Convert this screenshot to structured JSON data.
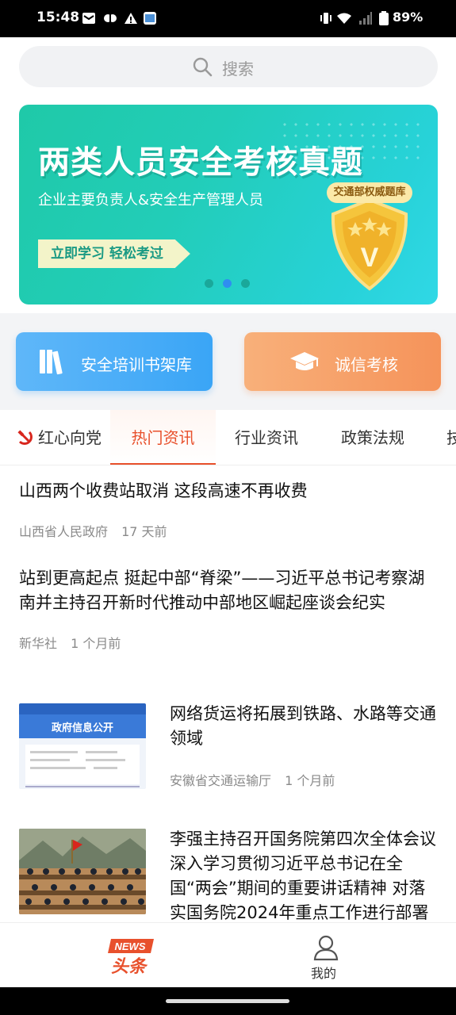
{
  "status_bar": {
    "time": "15:48",
    "battery": "89%"
  },
  "search": {
    "placeholder": "搜索"
  },
  "banner": {
    "title": "两类人员安全考核真题",
    "subtitle": "企业主要负责人&安全生产管理人员",
    "cta": "立即学习 轻松考过",
    "tag": "交通部权威题库",
    "shield_letter": "V",
    "dots": 3,
    "active_dot": 2
  },
  "quick_actions": [
    {
      "label": "安全培训书架库",
      "icon": "books-icon"
    },
    {
      "label": "诚信考核",
      "icon": "graduation-cap-icon"
    }
  ],
  "tabs": [
    {
      "label": "红心向党",
      "icon": "hammer-sickle-icon"
    },
    {
      "label": "热门资讯",
      "active": true
    },
    {
      "label": "行业资讯"
    },
    {
      "label": "政策法规"
    },
    {
      "label": "技"
    }
  ],
  "news": [
    {
      "title": "山西两个收费站取消 这段高速不再收费",
      "source": "山西省人民政府",
      "time": "17 天前"
    },
    {
      "title": "站到更高起点 挺起中部“脊梁”——习近平总书记考察湖南并主持召开新时代推动中部地区崛起座谈会纪实",
      "source": "新华社",
      "time": "1 个月前"
    },
    {
      "title": "网络货运将拓展到铁路、水路等交通领域",
      "source": "安徽省交通运输厅",
      "time": "1 个月前",
      "thumb_caption": "政府信息公开"
    },
    {
      "title": "李强主持召开国务院第四次全体会议 深入学习贯彻习近平总书记在全国“两会”期间的重要讲话精神 对落实国务院2024年重点工作进行部署",
      "source": "",
      "time": ""
    }
  ],
  "bottom_nav": {
    "news_logo_top": "NEWS",
    "news_logo_bottom": "头条",
    "me_label": "我的"
  },
  "colors": {
    "accent": "#e8502c",
    "banner": "#22cdb8",
    "blue_btn": "#3aa5f6",
    "orange_btn": "#f5935a"
  }
}
